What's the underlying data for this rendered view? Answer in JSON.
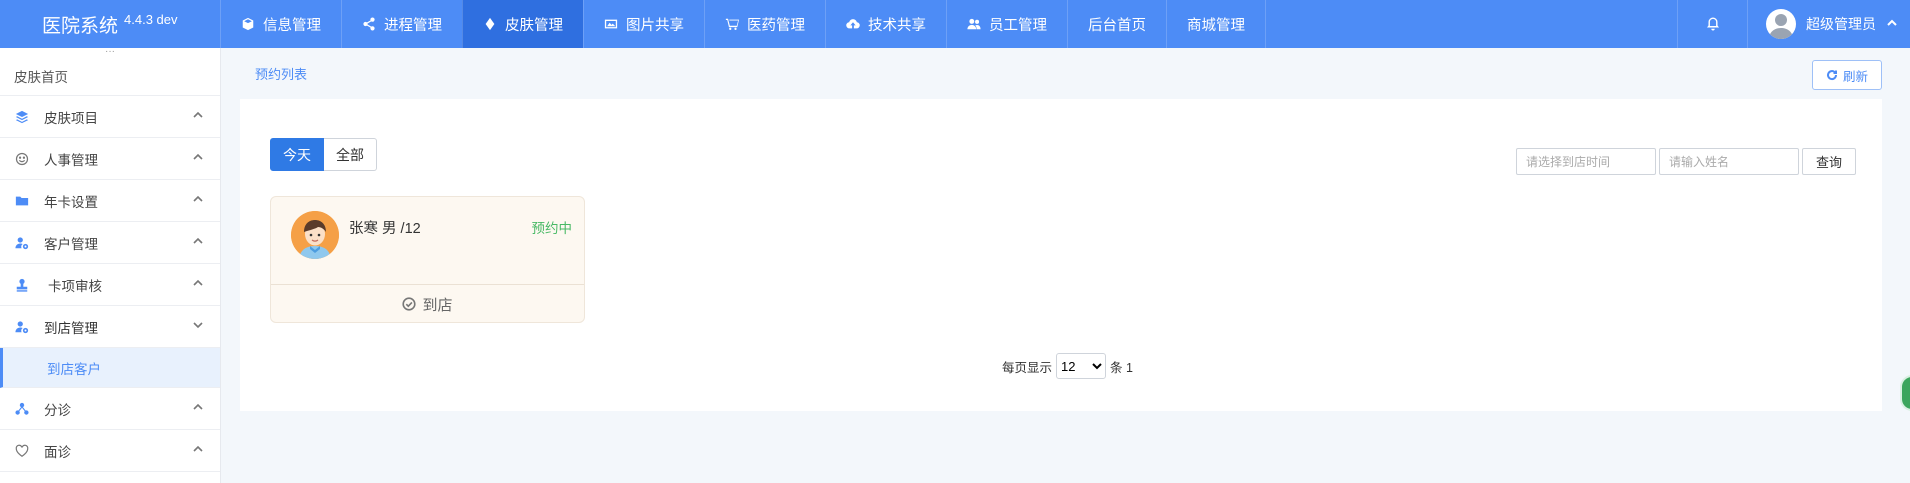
{
  "app": {
    "title": "医院系统",
    "version": "4.4.3 dev"
  },
  "topnav": [
    {
      "label": "信息管理",
      "icon": "cube-icon",
      "active": false
    },
    {
      "label": "进程管理",
      "icon": "share-icon",
      "active": false
    },
    {
      "label": "皮肤管理",
      "icon": "diamond-icon",
      "active": true
    },
    {
      "label": "图片共享",
      "icon": "image-icon",
      "active": false
    },
    {
      "label": "医药管理",
      "icon": "cart-icon",
      "active": false
    },
    {
      "label": "技术共享",
      "icon": "cloud-upload-icon",
      "active": false
    },
    {
      "label": "员工管理",
      "icon": "users-icon",
      "active": false
    },
    {
      "label": "后台首页",
      "icon": "",
      "active": false
    },
    {
      "label": "商城管理",
      "icon": "",
      "active": false
    }
  ],
  "user": {
    "name": "超级管理员"
  },
  "sidebar": {
    "home": "皮肤首页",
    "items": [
      {
        "label": "皮肤项目",
        "icon": "layers-icon",
        "expanded": false
      },
      {
        "label": "人事管理",
        "icon": "smile-icon",
        "expanded": false
      },
      {
        "label": "年卡设置",
        "icon": "folder-icon",
        "expanded": false
      },
      {
        "label": "客户管理",
        "icon": "user-gear-icon",
        "expanded": false
      },
      {
        "label": "卡项审核",
        "icon": "stamp-icon",
        "expanded": false
      },
      {
        "label": "到店管理",
        "icon": "user-gear-icon",
        "expanded": true
      },
      {
        "label": "分诊",
        "icon": "network-icon",
        "expanded": false
      },
      {
        "label": "面诊",
        "icon": "heart-icon",
        "expanded": false
      }
    ],
    "sub_active": "到店客户"
  },
  "breadcrumb": "预约列表",
  "refresh_label": "刷新",
  "tabs": {
    "today": "今天",
    "all": "全部"
  },
  "search": {
    "date_placeholder": "请选择到店时间",
    "name_placeholder": "请输入姓名",
    "query_label": "查询"
  },
  "card": {
    "name_line": "张寒 男 /12",
    "status": "预约中",
    "action": "到店"
  },
  "pager": {
    "prefix": "每页显示",
    "page_size": "12",
    "suffix": "条 1"
  },
  "colors": {
    "primary": "#4d8cf6",
    "active_nav": "#2f6fe0",
    "status_green": "#48b965"
  }
}
